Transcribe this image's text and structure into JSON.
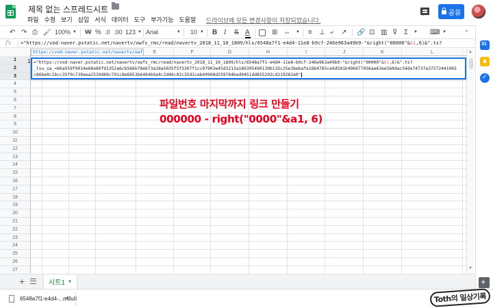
{
  "app": {
    "doc_title": "제목 없는 스프레드시트",
    "save_status": "드라이브에 모든 변경사항이 저장되었습니다.",
    "share_label": "공유"
  },
  "menu": [
    "파일",
    "수정",
    "보기",
    "삽입",
    "서식",
    "데이터",
    "도구",
    "부가기능",
    "도움말"
  ],
  "toolbar": {
    "undo": "↶",
    "redo": "↷",
    "print": "⎙",
    "paint_format": "🖌",
    "zoom": "100%",
    "currency": "₩",
    "percent": "%",
    "decimal_decrease": ".0",
    "decimal_increase": ".00",
    "number_format": "123",
    "font": "Arial",
    "font_size": "10",
    "bold": "B",
    "italic": "I",
    "strikethrough": "S",
    "text_color": "A"
  },
  "formula_bar": {
    "fx": "fx",
    "prefix": "=\"https://vod-naver.pstatic.net/navertv/owfs_rmc/read/navertv_2018_11_10_1809/hls/6548a7f1-e4d4-11e8-b9cf-246e963a49b9-\"&right(\"00000\"&",
    "ref": "A1",
    "suffix": ",6)&\".ts?"
  },
  "grid": {
    "tooltip_url": "https://vod-naver.pstatic.net/navertv/owfs...",
    "column_letters": [
      "A",
      "B",
      "C",
      "D",
      "E",
      "F",
      "G",
      "H",
      "I",
      "J",
      "K",
      "L"
    ],
    "row_numbers": [
      "1",
      "2",
      "3",
      "4",
      "5",
      "6",
      "7",
      "8",
      "9",
      "10",
      "11",
      "12",
      "13",
      "14",
      "15",
      "16",
      "17",
      "18",
      "19",
      "20",
      "21",
      "22",
      "23",
      "24",
      "25",
      "26",
      "27"
    ],
    "cell_a1": "1",
    "edit_lines": [
      {
        "pre": "=\"https://vod-naver.pstatic.net/navertv/owfs_rmc/read/navertv_2018_11_10_1809/hls/6548a7f1-e4d4-11e8-b9cf-246e963a49b9-\"&right(\"00000\"&",
        "ref": "A1",
        "post": ",6)&\".ts?"
      },
      {
        "pre": "_lsu_sa_=66a559f9014e68e60fd1352a6cb566b78eb73a18a5035f5f3307f1cc07903e45d3213a186395490130b135c25e3bebafa18b4785ce6d581b496677056ae63ee5b0dac54de74737e37572441065",
        "ref": "",
        "post": ""
      },
      {
        "pre": "c86be0c1bcc35f0c739aea2539d69c791c8e6853b6464b9a4c2d48c02c35d2ceb49908d259764bed9451dd855292cd219282e0\"",
        "ref": "",
        "post": ""
      }
    ]
  },
  "annotation": {
    "line1": "파일번호 마지막까지 링크 만들기",
    "line2": "000000 - right(\"0000\"&a1, 6)"
  },
  "sheet_tab": {
    "label": "시트1"
  },
  "download": {
    "filename": "6548a7f1-e4d4-...m3u8"
  },
  "watermark": {
    "text": "Toth의 일상기록"
  },
  "colors": {
    "accent": "#1a73e8",
    "sheets_green": "#0f9d58",
    "annotation_red": "#e8001c",
    "sheet_tab_text": "#188038"
  }
}
